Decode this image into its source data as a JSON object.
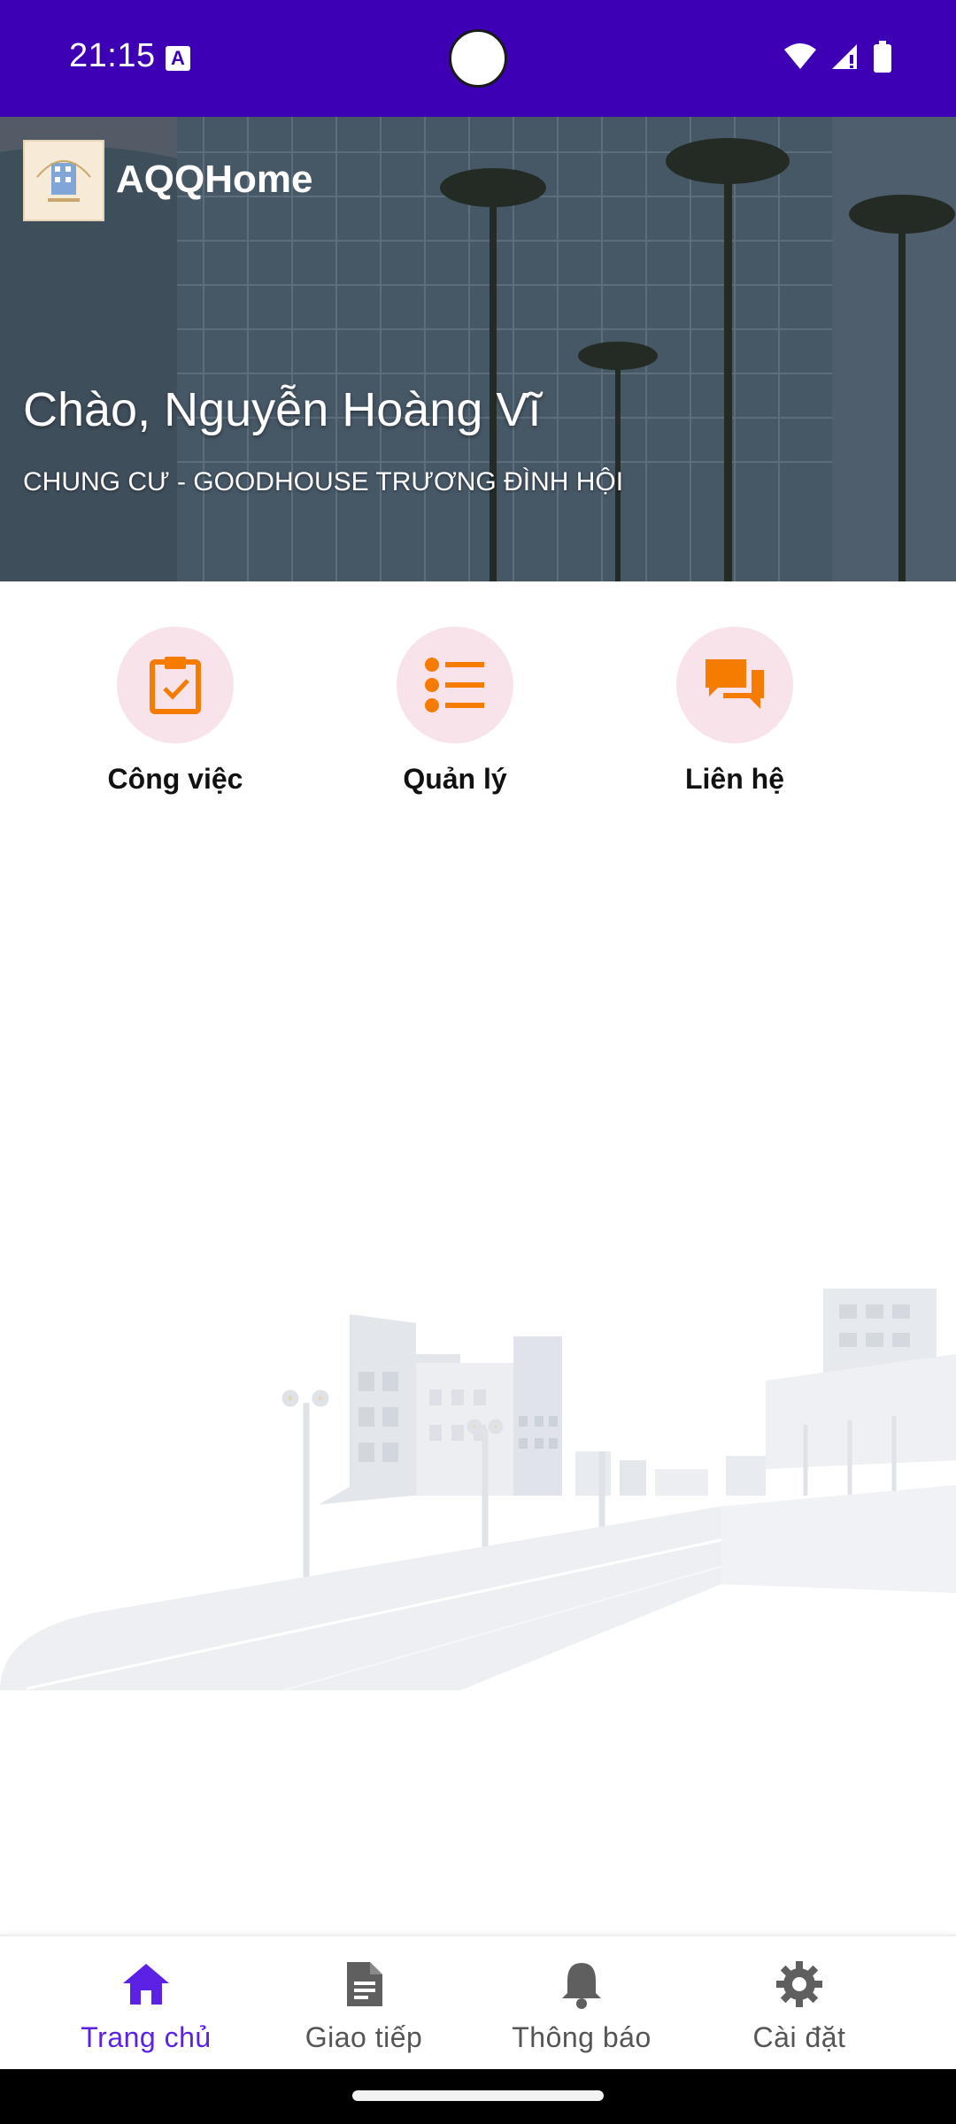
{
  "status_bar": {
    "time": "21:15",
    "notification_icon": "a-icon",
    "icons": [
      "wifi-icon",
      "signal-icon",
      "battery-icon"
    ]
  },
  "header": {
    "app_name": "AQQHome",
    "greeting": "Chào, Nguyễn Hoàng Vĩ",
    "building": "CHUNG CƯ - GOODHOUSE TRƯƠNG ĐÌNH HỘI"
  },
  "actions": [
    {
      "label": "Công việc",
      "icon": "clipboard-check-icon"
    },
    {
      "label": "Quản lý",
      "icon": "list-icon"
    },
    {
      "label": "Liên hệ",
      "icon": "chat-icon"
    }
  ],
  "bottom_nav": [
    {
      "label": "Trang chủ",
      "icon": "home-icon",
      "active": true
    },
    {
      "label": "Giao tiếp",
      "icon": "document-icon",
      "active": false
    },
    {
      "label": "Thông báo",
      "icon": "bell-icon",
      "active": false
    },
    {
      "label": "Cài đặt",
      "icon": "gear-icon",
      "active": false
    }
  ],
  "colors": {
    "status_bar": "#3d00b5",
    "accent": "#5b22e6",
    "action_icon": "#f57c00",
    "action_circle": "#f8e3ea"
  }
}
